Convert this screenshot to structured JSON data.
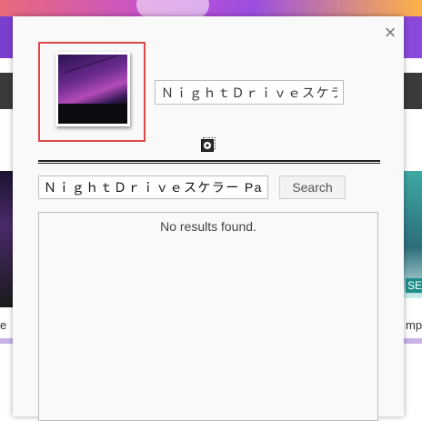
{
  "background": {
    "left_caption": "e",
    "right_caption": "mp",
    "right_badge": "SE"
  },
  "dialog": {
    "close_symbol": "×",
    "title_value": "ＮｉｇｈｔＤｒｉｖｅスケラー Part I",
    "icon": "cd-record-icon",
    "search": {
      "value": "ＮｉｇｈｔＤｒｉｖｅスケラー Part I",
      "button_label": "Search"
    },
    "results": {
      "message": "No results found."
    }
  },
  "colors": {
    "selection_border": "#e04848",
    "divider": "#222222"
  }
}
